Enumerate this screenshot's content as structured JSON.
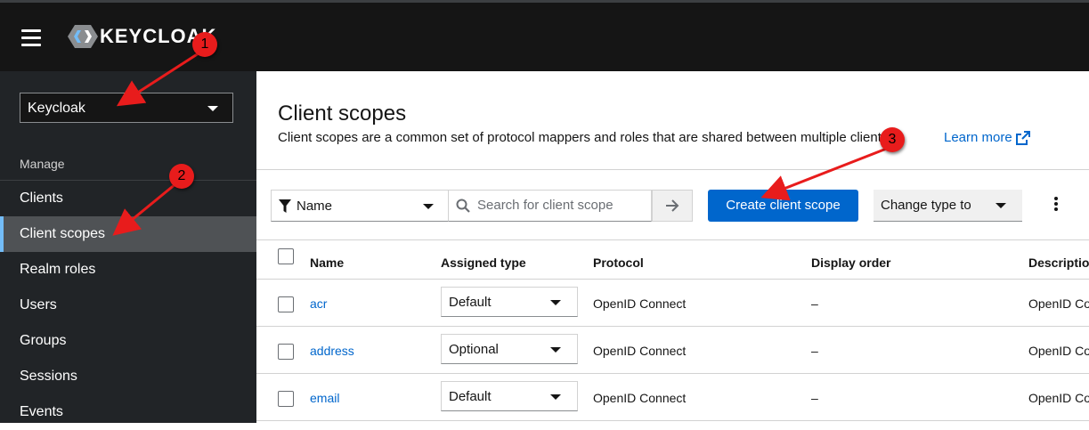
{
  "brand": {
    "logo_text": "KEYCLOAK"
  },
  "realm_selector": {
    "value": "Keycloak"
  },
  "sidebar": {
    "section_label": "Manage",
    "items": [
      {
        "label": "Clients",
        "active": false
      },
      {
        "label": "Client scopes",
        "active": true
      },
      {
        "label": "Realm roles",
        "active": false
      },
      {
        "label": "Users",
        "active": false
      },
      {
        "label": "Groups",
        "active": false
      },
      {
        "label": "Sessions",
        "active": false
      },
      {
        "label": "Events",
        "active": false
      }
    ]
  },
  "page": {
    "title": "Client scopes",
    "description": "Client scopes are a common set of protocol mappers and roles that are shared between multiple clients.",
    "learn_more": "Learn more"
  },
  "toolbar": {
    "filter_value": "Name",
    "search_placeholder": "Search for client scope",
    "create_label": "Create client scope",
    "change_type_label": "Change type to"
  },
  "table": {
    "headers": [
      "Name",
      "Assigned type",
      "Protocol",
      "Display order",
      "Description"
    ],
    "rows": [
      {
        "name": "acr",
        "assigned_type": "Default",
        "protocol": "OpenID Connect",
        "display_order": "–",
        "description": "OpenID Co"
      },
      {
        "name": "address",
        "assigned_type": "Optional",
        "protocol": "OpenID Connect",
        "display_order": "–",
        "description": "OpenID Co"
      },
      {
        "name": "email",
        "assigned_type": "Default",
        "protocol": "OpenID Connect",
        "display_order": "–",
        "description": "OpenID Co"
      }
    ]
  },
  "annotations": [
    "1",
    "2",
    "3"
  ],
  "colors": {
    "masthead": "#151515",
    "sidebar": "#212427",
    "primary": "#0066cc",
    "annotation": "#e81c1c"
  }
}
